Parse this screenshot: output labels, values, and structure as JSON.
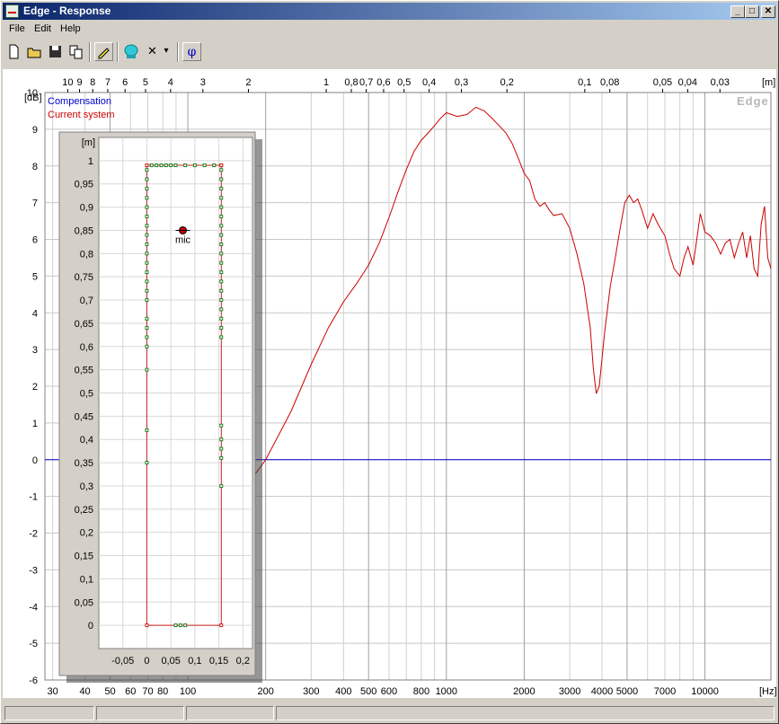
{
  "window": {
    "title": "Edge - Response"
  },
  "title_buttons": {
    "minimize": "_",
    "maximize": "□",
    "close": "✕"
  },
  "menu": [
    "File",
    "Edit",
    "Help"
  ],
  "toolbar": {
    "icons": [
      "new-file-icon",
      "open-folder-icon",
      "save-icon",
      "copy-icon",
      "pencil-icon",
      "speaker-icon",
      "close-x-icon",
      "dropdown-arrow-icon",
      "phi-icon"
    ],
    "phi_label": "φ",
    "x_label": "✕",
    "arrow_label": "▾"
  },
  "plot": {
    "watermark": "Edge",
    "legend": [
      {
        "label": "Compensation",
        "color": "#0000cc"
      },
      {
        "label": "Current system",
        "color": "#cc0000"
      }
    ],
    "y_unit": "[dB]",
    "x_unit": "[Hz]",
    "top_unit": "[m]",
    "y_ticks": [
      "10",
      "9",
      "8",
      "7",
      "6",
      "5",
      "4",
      "3",
      "2",
      "1",
      "0",
      "-1",
      "-2",
      "-3",
      "-4",
      "-5",
      "-6"
    ],
    "x_ticks": [
      "30",
      "40",
      "50",
      "60",
      "70",
      "80",
      "100",
      "200",
      "300",
      "400",
      "500",
      "600",
      "800",
      "1000",
      "2000",
      "3000",
      "4000",
      "5000",
      "7000",
      "10000"
    ],
    "top_ticks": [
      "10",
      "9",
      "8",
      "7",
      "6",
      "5",
      "4",
      "3",
      "2",
      "1",
      "0,8",
      "0,7",
      "0,6",
      "0,5",
      "0,4",
      "0,3",
      "0,2",
      "0,1",
      "0,08",
      "0,05",
      "0,04",
      "0,03"
    ]
  },
  "inset": {
    "y_unit": "[m]",
    "y_ticks": [
      "1",
      "0,95",
      "0,9",
      "0,85",
      "0,8",
      "0,75",
      "0,7",
      "0,65",
      "0,6",
      "0,55",
      "0,5",
      "0,45",
      "0,4",
      "0,35",
      "0,3",
      "0,25",
      "0,2",
      "0,15",
      "0,1",
      "0,05",
      "0"
    ],
    "x_ticks": [
      "-0,05",
      "0",
      "0,05",
      "0,1",
      "0,15",
      "0,2"
    ],
    "mic_label": "mic"
  },
  "chart_data": {
    "type": "line",
    "x_scale": "log",
    "xlim": [
      28,
      18000
    ],
    "ylim": [
      -6,
      10
    ],
    "series": [
      {
        "name": "Compensation",
        "color": "#0000cc",
        "points": [
          [
            28,
            0
          ],
          [
            18000,
            0
          ]
        ]
      },
      {
        "name": "Current system",
        "color": "#cc0000",
        "points": [
          [
            100,
            -2.8
          ],
          [
            150,
            -1.2
          ],
          [
            200,
            0
          ],
          [
            250,
            1.3
          ],
          [
            300,
            2.6
          ],
          [
            350,
            3.6
          ],
          [
            400,
            4.3
          ],
          [
            450,
            4.8
          ],
          [
            500,
            5.3
          ],
          [
            550,
            5.9
          ],
          [
            600,
            6.6
          ],
          [
            650,
            7.3
          ],
          [
            700,
            7.9
          ],
          [
            750,
            8.4
          ],
          [
            800,
            8.7
          ],
          [
            850,
            8.9
          ],
          [
            900,
            9.1
          ],
          [
            950,
            9.3
          ],
          [
            1000,
            9.45
          ],
          [
            1100,
            9.35
          ],
          [
            1200,
            9.4
          ],
          [
            1300,
            9.6
          ],
          [
            1400,
            9.5
          ],
          [
            1500,
            9.3
          ],
          [
            1600,
            9.1
          ],
          [
            1700,
            8.9
          ],
          [
            1800,
            8.6
          ],
          [
            1900,
            8.2
          ],
          [
            2000,
            7.8
          ],
          [
            2100,
            7.6
          ],
          [
            2200,
            7.1
          ],
          [
            2300,
            6.9
          ],
          [
            2400,
            7.0
          ],
          [
            2500,
            6.8
          ],
          [
            2600,
            6.65
          ],
          [
            2800,
            6.7
          ],
          [
            3000,
            6.3
          ],
          [
            3200,
            5.6
          ],
          [
            3400,
            4.8
          ],
          [
            3600,
            3.6
          ],
          [
            3700,
            2.5
          ],
          [
            3800,
            1.8
          ],
          [
            3900,
            2.0
          ],
          [
            4100,
            3.5
          ],
          [
            4300,
            4.7
          ],
          [
            4500,
            5.5
          ],
          [
            4700,
            6.3
          ],
          [
            4900,
            7.0
          ],
          [
            5100,
            7.2
          ],
          [
            5300,
            7.0
          ],
          [
            5500,
            7.1
          ],
          [
            5700,
            6.8
          ],
          [
            6000,
            6.3
          ],
          [
            6300,
            6.7
          ],
          [
            6600,
            6.4
          ],
          [
            7000,
            6.1
          ],
          [
            7300,
            5.6
          ],
          [
            7600,
            5.2
          ],
          [
            8000,
            5.0
          ],
          [
            8300,
            5.5
          ],
          [
            8600,
            5.8
          ],
          [
            9000,
            5.3
          ],
          [
            9300,
            6.0
          ],
          [
            9600,
            6.7
          ],
          [
            10000,
            6.2
          ],
          [
            10500,
            6.1
          ],
          [
            11000,
            5.9
          ],
          [
            11500,
            5.6
          ],
          [
            12000,
            5.9
          ],
          [
            12500,
            6.0
          ],
          [
            13000,
            5.5
          ],
          [
            13500,
            5.9
          ],
          [
            14000,
            6.2
          ],
          [
            14500,
            5.5
          ],
          [
            15000,
            6.1
          ],
          [
            15500,
            5.2
          ],
          [
            16000,
            5.0
          ],
          [
            16500,
            6.4
          ],
          [
            17000,
            6.9
          ],
          [
            17500,
            5.5
          ],
          [
            18000,
            5.2
          ]
        ]
      }
    ]
  },
  "room": {
    "xlim": [
      -0.1,
      0.22
    ],
    "ylim": [
      -0.05,
      1.05
    ],
    "outline": [
      [
        0,
        0
      ],
      [
        0.155,
        0
      ],
      [
        0.155,
        0.99
      ],
      [
        0,
        0.99
      ],
      [
        0,
        0
      ]
    ],
    "sources_bottom": [
      [
        0.06,
        0
      ],
      [
        0.07,
        0
      ],
      [
        0.08,
        0
      ]
    ],
    "sources_top_x": [
      0,
      0.01,
      0.02,
      0.03,
      0.04,
      0.05,
      0.06,
      0.08,
      0.1,
      0.12,
      0.14,
      0.155
    ],
    "sources_left_y": [
      0.35,
      0.42,
      0.55,
      0.6,
      0.62,
      0.64,
      0.66,
      0.7,
      0.72,
      0.74,
      0.76,
      0.78,
      0.8,
      0.82,
      0.84,
      0.86,
      0.88,
      0.9,
      0.92,
      0.94,
      0.96,
      0.98
    ],
    "sources_right_y": [
      0.3,
      0.36,
      0.38,
      0.4,
      0.43,
      0.62,
      0.64,
      0.66,
      0.68,
      0.7,
      0.72,
      0.74,
      0.76,
      0.78,
      0.8,
      0.82,
      0.84,
      0.86,
      0.88,
      0.9,
      0.92,
      0.94,
      0.96,
      0.98
    ],
    "mic": [
      0.075,
      0.85
    ]
  }
}
